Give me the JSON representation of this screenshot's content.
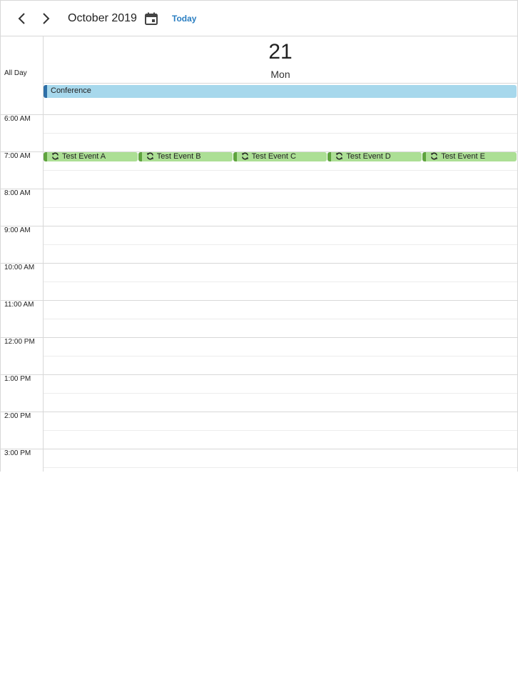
{
  "toolbar": {
    "prev_icon": "chevron-left-icon",
    "next_icon": "chevron-right-icon",
    "month_title": "October 2019",
    "calendar_icon": "calendar-icon",
    "today_label": "Today"
  },
  "day": {
    "number": "21",
    "name": "Mon"
  },
  "allday": {
    "label": "All Day",
    "events": [
      {
        "title": "Conference"
      }
    ]
  },
  "hours": [
    "6:00 AM",
    "7:00 AM",
    "8:00 AM",
    "9:00 AM",
    "10:00 AM",
    "11:00 AM",
    "12:00 PM",
    "1:00 PM",
    "2:00 PM",
    "3:00 PM"
  ],
  "timed_events": [
    {
      "title": "Test Event A",
      "icon": "recurring-icon"
    },
    {
      "title": "Test Event B",
      "icon": "recurring-icon"
    },
    {
      "title": "Test Event C",
      "icon": "recurring-icon"
    },
    {
      "title": "Test Event D",
      "icon": "recurring-icon"
    },
    {
      "title": "Test Event E",
      "icon": "recurring-icon"
    }
  ],
  "colors": {
    "allday_event_bg": "#a7d8ec",
    "allday_event_accent": "#2e6fa7",
    "timed_event_bg": "#acdf95",
    "timed_event_accent": "#5fa33f",
    "today_link": "#2b7fc2"
  }
}
